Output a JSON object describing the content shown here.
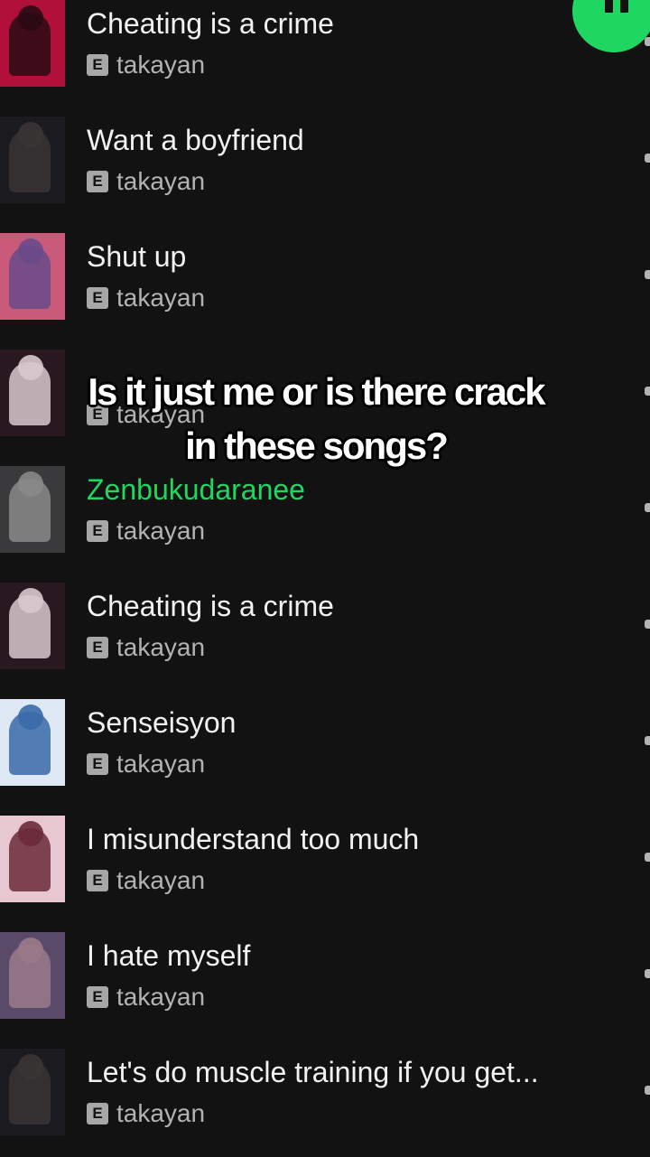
{
  "playback": {
    "state": "playing",
    "accent_color": "#1ed760"
  },
  "caption": {
    "line1": "Is it just me or is there crack",
    "line2": "in these songs?"
  },
  "tracks": [
    {
      "title": "Cheating is a crime",
      "artist": "takayan",
      "explicit": "E",
      "art_color": "#b0103a",
      "art_accent": "#2a0a14",
      "playing": false
    },
    {
      "title": "Want a boyfriend",
      "artist": "takayan",
      "explicit": "E",
      "art_color": "#1a1a1f",
      "art_accent": "#3a3535",
      "playing": false
    },
    {
      "title": "Shut up",
      "artist": "takayan",
      "explicit": "E",
      "art_color": "#c95a7a",
      "art_accent": "#6a4a8a",
      "playing": false
    },
    {
      "title": "",
      "artist": "takayan",
      "explicit": "E",
      "art_color": "#2a1820",
      "art_accent": "#d8c8cc",
      "playing": false
    },
    {
      "title": "Zenbukudaranee",
      "artist": "takayan",
      "explicit": "E",
      "art_color": "#3a3a3c",
      "art_accent": "#8a8a8a",
      "playing": true
    },
    {
      "title": "Cheating is a crime",
      "artist": "takayan",
      "explicit": "E",
      "art_color": "#2a1820",
      "art_accent": "#d8c8cc",
      "playing": false
    },
    {
      "title": "Senseisyon",
      "artist": "takayan",
      "explicit": "E",
      "art_color": "#dfe8f5",
      "art_accent": "#3a6aa8",
      "playing": false
    },
    {
      "title": "I misunderstand too much",
      "artist": "takayan",
      "explicit": "E",
      "art_color": "#e8c8d0",
      "art_accent": "#6a2a3a",
      "playing": false
    },
    {
      "title": "I hate myself",
      "artist": "takayan",
      "explicit": "E",
      "art_color": "#5a4a6a",
      "art_accent": "#9a7a8a",
      "playing": false
    },
    {
      "title": "Let's do muscle training if you get...",
      "artist": "takayan",
      "explicit": "E",
      "art_color": "#1a1a1f",
      "art_accent": "#3a3535",
      "playing": false
    }
  ]
}
